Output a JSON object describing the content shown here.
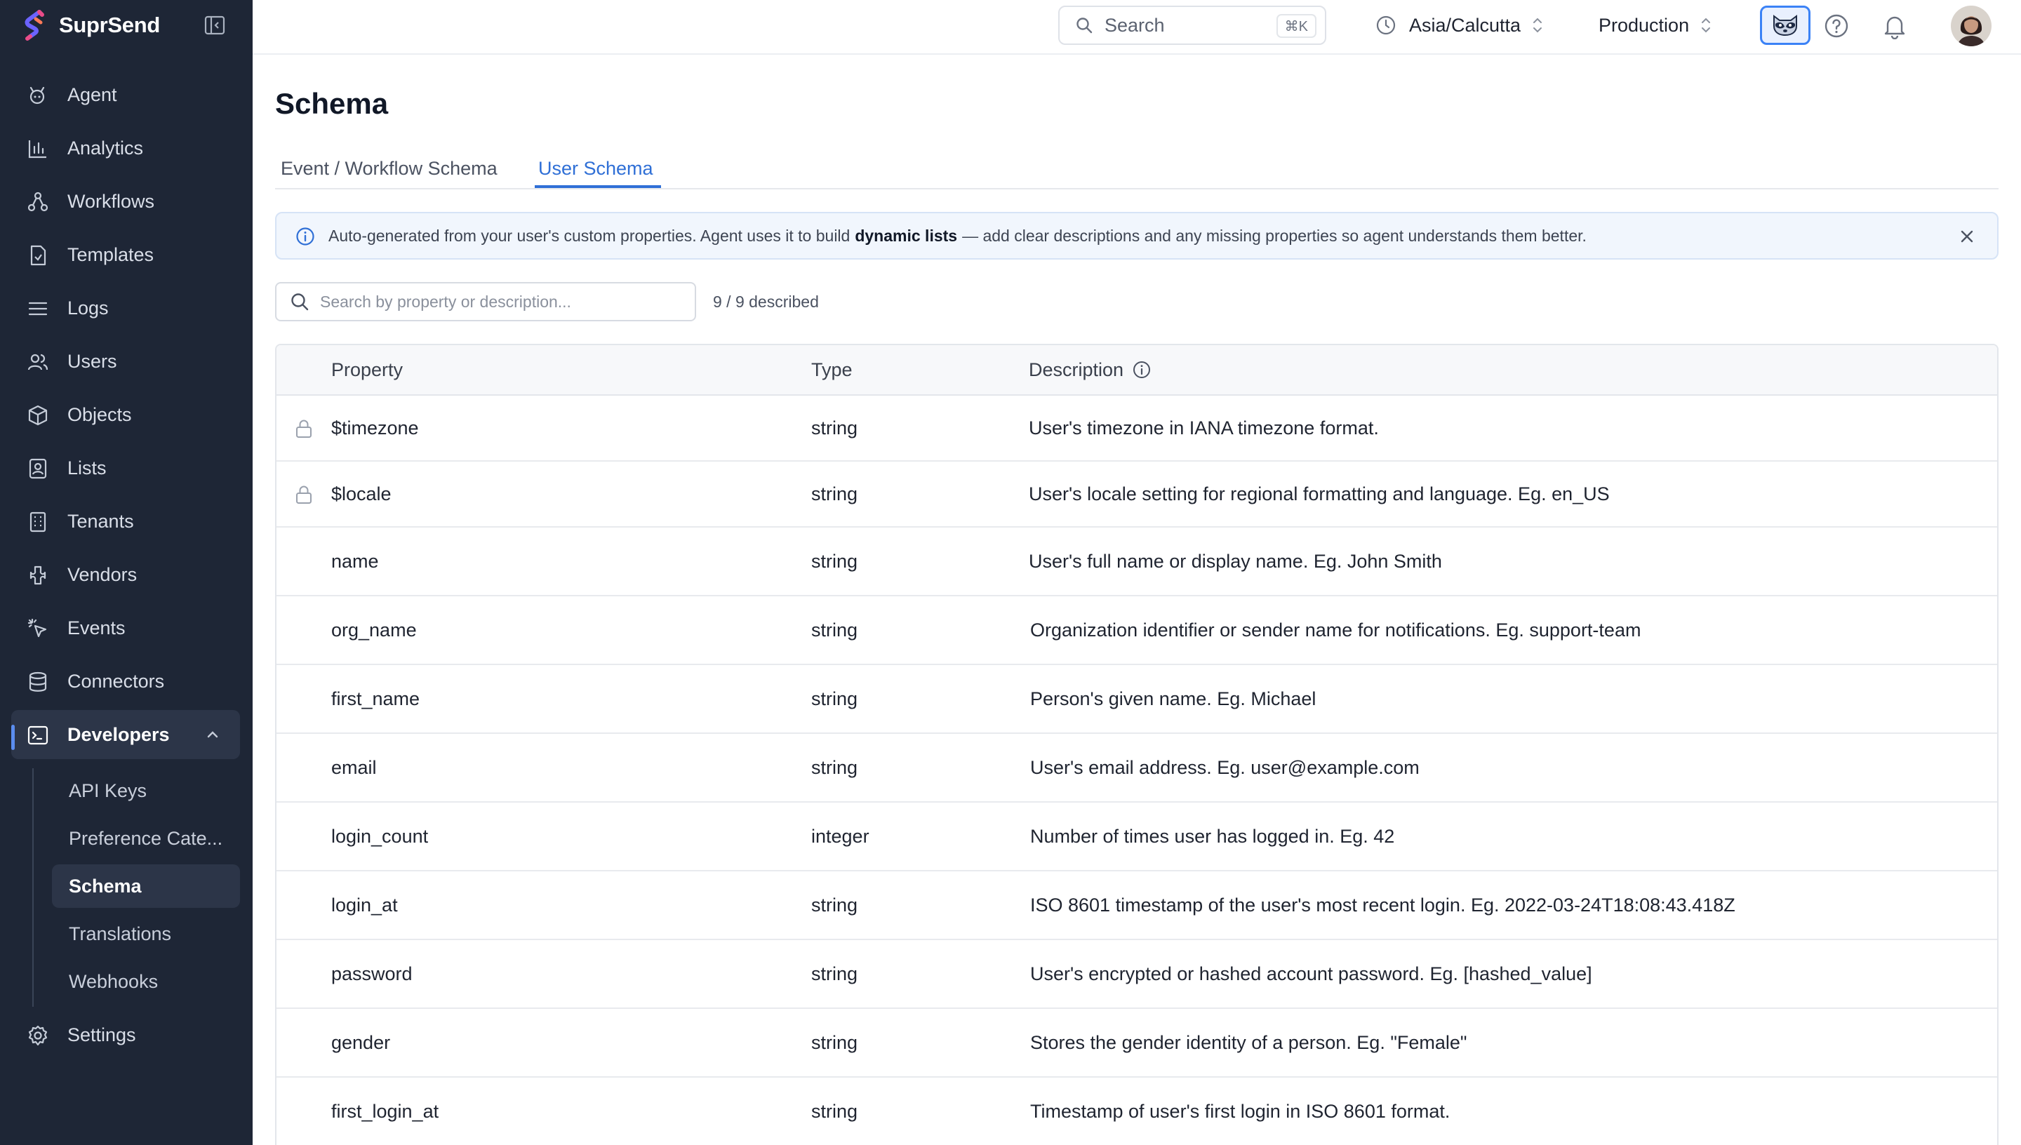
{
  "brand": {
    "name": "SuprSend"
  },
  "colors": {
    "sidebar_bg": "#1e2636",
    "accent": "#2f6fd6",
    "banner_bg": "#f1f6fd",
    "active_bar": "#5b8def"
  },
  "sidebar": {
    "items": [
      {
        "label": "Agent",
        "icon": "agent-icon"
      },
      {
        "label": "Analytics",
        "icon": "analytics-icon"
      },
      {
        "label": "Workflows",
        "icon": "workflows-icon"
      },
      {
        "label": "Templates",
        "icon": "templates-icon"
      },
      {
        "label": "Logs",
        "icon": "logs-icon"
      },
      {
        "label": "Users",
        "icon": "users-icon"
      },
      {
        "label": "Objects",
        "icon": "objects-icon"
      },
      {
        "label": "Lists",
        "icon": "lists-icon"
      },
      {
        "label": "Tenants",
        "icon": "tenants-icon"
      },
      {
        "label": "Vendors",
        "icon": "vendors-icon"
      },
      {
        "label": "Events",
        "icon": "events-icon"
      },
      {
        "label": "Connectors",
        "icon": "connectors-icon"
      },
      {
        "label": "Developers",
        "icon": "developers-icon",
        "active": true
      },
      {
        "label": "Settings",
        "icon": "settings-icon"
      }
    ],
    "developer_sub": [
      {
        "label": "API Keys"
      },
      {
        "label": "Preference Cate..."
      },
      {
        "label": "Schema",
        "active": true
      },
      {
        "label": "Translations"
      },
      {
        "label": "Webhooks"
      }
    ]
  },
  "topbar": {
    "search_label": "Search",
    "search_shortcut": "⌘K",
    "timezone": "Asia/Calcutta",
    "environment": "Production"
  },
  "page": {
    "title": "Schema",
    "tabs": [
      {
        "label": "Event / Workflow Schema"
      },
      {
        "label": "User Schema",
        "active": true
      }
    ],
    "banner": {
      "text_before": "Auto-generated from your user's custom properties. Agent uses it to build",
      "text_bold": "dynamic lists",
      "text_after": "— add clear descriptions and any missing properties so agent understands them better."
    },
    "filter_placeholder": "Search by property or description...",
    "described_count": "9 / 9 described"
  },
  "table": {
    "headers": {
      "property": "Property",
      "type": "Type",
      "description": "Description"
    },
    "rows": [
      {
        "property": "$timezone",
        "type": "string",
        "description": "User's timezone in IANA timezone format.",
        "locked": true
      },
      {
        "property": "$locale",
        "type": "string",
        "description": "User's locale setting for regional formatting and language. Eg. en_US",
        "locked": true
      },
      {
        "property": "name",
        "type": "string",
        "description": "User's full name or display name. Eg. John Smith"
      },
      {
        "property": "org_name",
        "type": "string",
        "description": "Organization identifier or sender name for notifications. Eg. support-team"
      },
      {
        "property": "first_name",
        "type": "string",
        "description": "Person's given name. Eg. Michael"
      },
      {
        "property": "email",
        "type": "string",
        "description": "User's email address. Eg. user@example.com"
      },
      {
        "property": "login_count",
        "type": "integer",
        "description": "Number of times user has logged in. Eg. 42"
      },
      {
        "property": "login_at",
        "type": "string",
        "description": "ISO 8601 timestamp of the user's most recent login. Eg. 2022-03-24T18:08:43.418Z"
      },
      {
        "property": "password",
        "type": "string",
        "description": "User's encrypted or hashed account password. Eg. [hashed_value]"
      },
      {
        "property": "gender",
        "type": "string",
        "description": "Stores the gender identity of a person. Eg. \"Female\""
      },
      {
        "property": "first_login_at",
        "type": "string",
        "description": "Timestamp of user's first login in ISO 8601 format."
      }
    ]
  }
}
